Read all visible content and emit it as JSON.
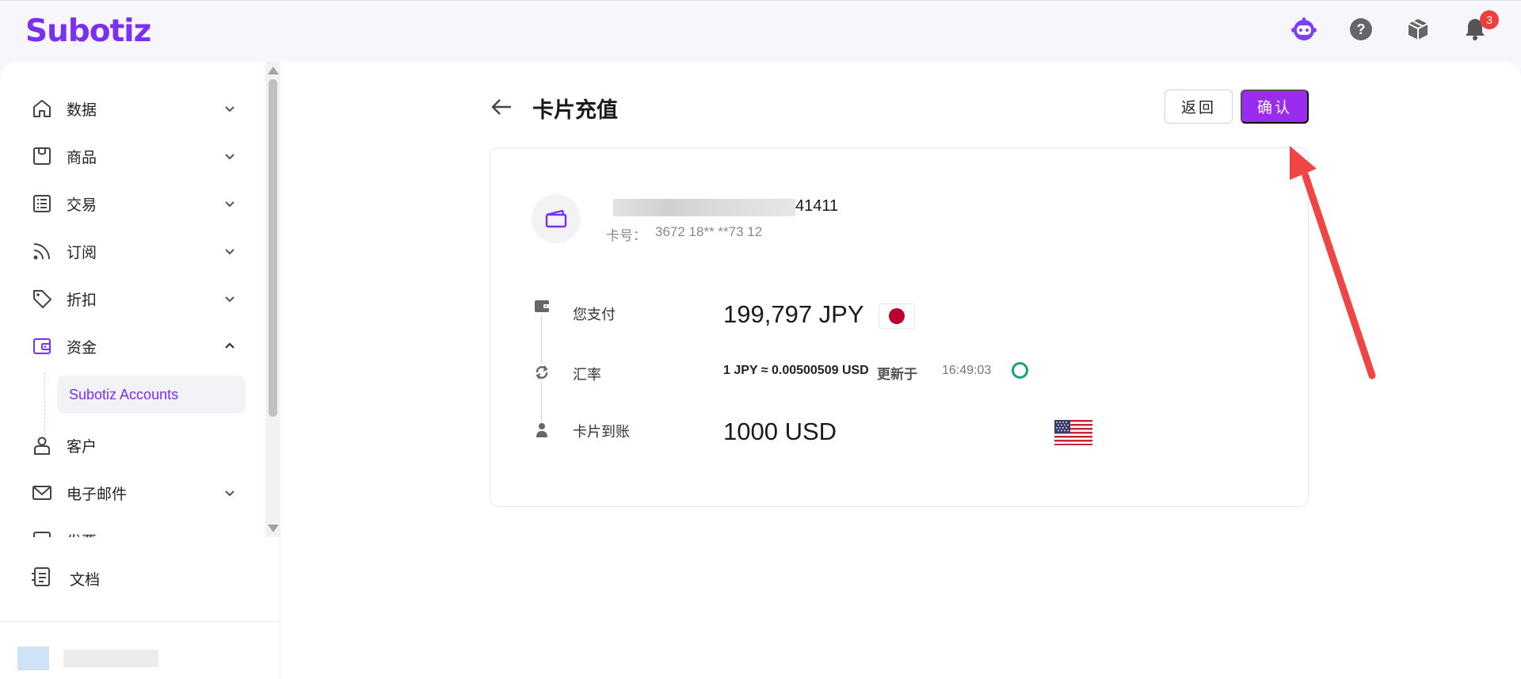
{
  "header": {
    "logo": "Subotiz",
    "icons": [
      "assistant-bot-icon",
      "help-icon",
      "package-icon",
      "bell-icon"
    ],
    "notification_count": "3"
  },
  "sidebar": {
    "items": [
      {
        "label": "数据",
        "icon": "home-icon",
        "expanded": false
      },
      {
        "label": "商品",
        "icon": "store-icon",
        "expanded": false
      },
      {
        "label": "交易",
        "icon": "list-icon",
        "expanded": false
      },
      {
        "label": "订阅",
        "icon": "rss-icon",
        "expanded": false
      },
      {
        "label": "折扣",
        "icon": "tag-icon",
        "expanded": false
      },
      {
        "label": "资金",
        "icon": "wallet-icon",
        "expanded": true
      },
      {
        "label": "客户",
        "icon": "user-icon",
        "expanded": false
      },
      {
        "label": "电子邮件",
        "icon": "mail-icon",
        "expanded": false
      },
      {
        "label": "发票",
        "icon": "receipt-icon",
        "expanded": false
      }
    ],
    "sub_item": "Subotiz Accounts",
    "docs_label": "文档"
  },
  "page": {
    "title": "卡片充值",
    "return_label": "返回",
    "confirm_label": "确认"
  },
  "card": {
    "name_suffix": "41411",
    "card_number_label": "卡号：",
    "card_number": "3672 18** **73 12"
  },
  "details": {
    "pay_label": "您支付",
    "pay_amount": "199,797 JPY",
    "rate_label": "汇率",
    "rate_value": "1 JPY ≈ 0.00500509 USD",
    "updated_label": "更新于",
    "updated_time": "16:49:03",
    "receive_label": "卡片到账",
    "receive_amount": "1000 USD"
  },
  "colors": {
    "brand": "#7b2ff2",
    "confirm": "#9a2cf0",
    "annotation_arrow": "#f04545",
    "refresh_ring": "#16a37a"
  }
}
